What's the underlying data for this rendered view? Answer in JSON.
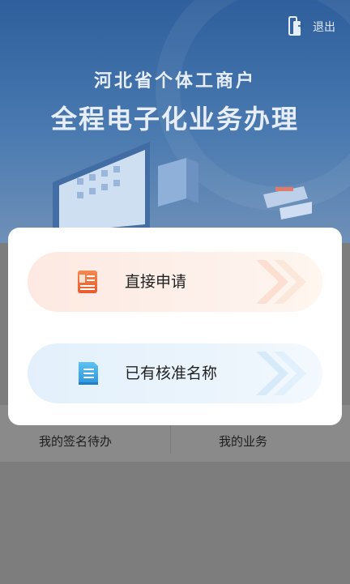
{
  "header": {
    "logout_label": "退出",
    "title_line1": "河北省个体工商户",
    "title_line2": "全程电子化业务办理"
  },
  "background_tabs": {
    "left_label": "我的签名待办",
    "right_label": "我的业务"
  },
  "modal": {
    "options": [
      {
        "label": "直接申请",
        "icon": "document-icon",
        "accent": "#f26b3a"
      },
      {
        "label": "已有核准名称",
        "icon": "document-lines-icon",
        "accent": "#3aa6e8"
      }
    ]
  }
}
